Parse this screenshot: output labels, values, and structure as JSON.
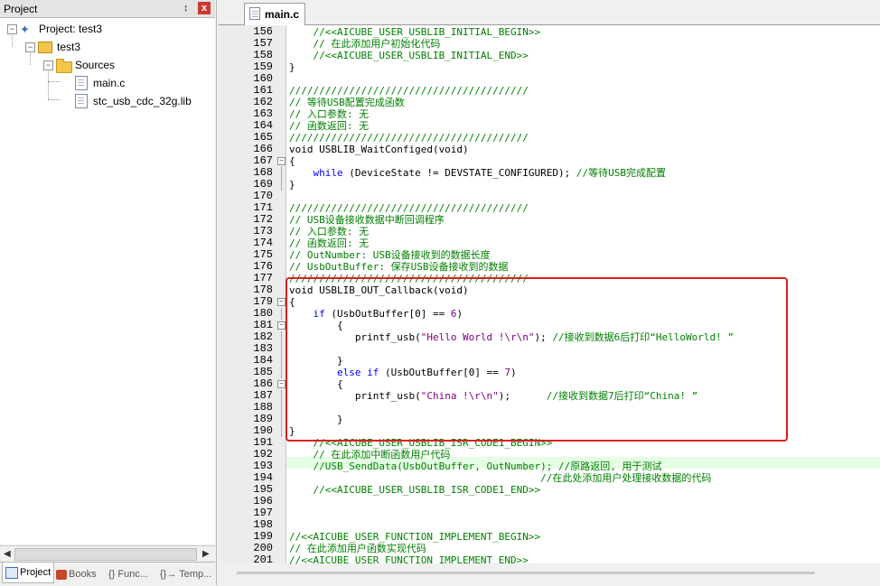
{
  "project_panel": {
    "title": "Project",
    "pin_glyph": "↕",
    "close_glyph": "x",
    "tree": [
      {
        "label": "Project: test3",
        "icon": "project-icon"
      },
      {
        "label": "test3",
        "icon": "target-icon"
      },
      {
        "label": "Sources",
        "icon": "folder-icon"
      },
      {
        "label": "main.c",
        "icon": "file-icon"
      },
      {
        "label": "stc_usb_cdc_32g.lib",
        "icon": "file-icon"
      }
    ],
    "tabs": [
      {
        "label": "Project",
        "active": true
      },
      {
        "label": "Books",
        "active": false
      },
      {
        "label": "{} Func...",
        "active": false
      },
      {
        "label": "{}→ Temp...",
        "active": false
      }
    ]
  },
  "editor": {
    "tab_label": "main.c",
    "accent_callout": "#d81f1f",
    "highlight_line_color": "#e5ffe5",
    "lines": [
      {
        "n": "156",
        "text": "    //<<AICUBE_USER_USBLIB_INITIAL_BEGIN>>"
      },
      {
        "n": "157",
        "text": "    // 在此添加用户初始化代码"
      },
      {
        "n": "158",
        "text": "    //<<AICUBE_USER_USBLIB_INITIAL_END>>"
      },
      {
        "n": "159",
        "text": "}"
      },
      {
        "n": "160",
        "text": ""
      },
      {
        "n": "161",
        "text": "////////////////////////////////////////"
      },
      {
        "n": "162",
        "text": "// 等待USB配置完成函数"
      },
      {
        "n": "163",
        "text": "// 入口参数: 无"
      },
      {
        "n": "164",
        "text": "// 函数返回: 无"
      },
      {
        "n": "165",
        "text": "////////////////////////////////////////"
      },
      {
        "n": "166",
        "text": "void USBLIB_WaitConfiged(void)"
      },
      {
        "n": "167",
        "text": "{"
      },
      {
        "n": "168",
        "text": "    while (DeviceState != DEVSTATE_CONFIGURED); //等待USB完成配置"
      },
      {
        "n": "169",
        "text": "}"
      },
      {
        "n": "170",
        "text": ""
      },
      {
        "n": "171",
        "text": "////////////////////////////////////////"
      },
      {
        "n": "172",
        "text": "// USB设备接收数据中断回调程序"
      },
      {
        "n": "173",
        "text": "// 入口参数: 无"
      },
      {
        "n": "174",
        "text": "// 函数返回: 无"
      },
      {
        "n": "175",
        "text": "// OutNumber: USB设备接收到的数据长度"
      },
      {
        "n": "176",
        "text": "// UsbOutBuffer: 保存USB设备接收到的数据"
      },
      {
        "n": "177",
        "text": "////////////////////////////////////////"
      },
      {
        "n": "178",
        "text": "void USBLIB_OUT_Callback(void)"
      },
      {
        "n": "179",
        "text": "{"
      },
      {
        "n": "180",
        "text": "    if (UsbOutBuffer[0] == 6)"
      },
      {
        "n": "181",
        "text": "        {"
      },
      {
        "n": "182",
        "text": "           printf_usb(\"Hello World !\\r\\n\"); //接收到数据6后打印“HelloWorld! ”"
      },
      {
        "n": "183",
        "text": ""
      },
      {
        "n": "184",
        "text": "        }"
      },
      {
        "n": "185",
        "text": "        else if (UsbOutBuffer[0] == 7)"
      },
      {
        "n": "186",
        "text": "        {"
      },
      {
        "n": "187",
        "text": "           printf_usb(\"China !\\r\\n\");      //接收到数据7后打印“China! ”"
      },
      {
        "n": "188",
        "text": ""
      },
      {
        "n": "189",
        "text": "        }"
      },
      {
        "n": "190",
        "text": "}"
      },
      {
        "n": "191",
        "text": "    //<<AICUBE_USER_USBLIB_ISR_CODE1_BEGIN>>"
      },
      {
        "n": "192",
        "text": "    // 在此添加中断函数用户代码"
      },
      {
        "n": "193",
        "text": "    //USB_SendData(UsbOutBuffer, OutNumber); //原路返回, 用于测试"
      },
      {
        "n": "194",
        "text": "                                          //在此处添加用户处理接收数据的代码"
      },
      {
        "n": "195",
        "text": "    //<<AICUBE_USER_USBLIB_ISR_CODE1_END>>"
      },
      {
        "n": "196",
        "text": ""
      },
      {
        "n": "197",
        "text": ""
      },
      {
        "n": "198",
        "text": ""
      },
      {
        "n": "199",
        "text": "//<<AICUBE_USER_FUNCTION_IMPLEMENT_BEGIN>>"
      },
      {
        "n": "200",
        "text": "// 在此添加用户函数实现代码"
      },
      {
        "n": "201",
        "text": "//<<AICUBE_USER_FUNCTION_IMPLEMENT_END>>"
      }
    ]
  }
}
